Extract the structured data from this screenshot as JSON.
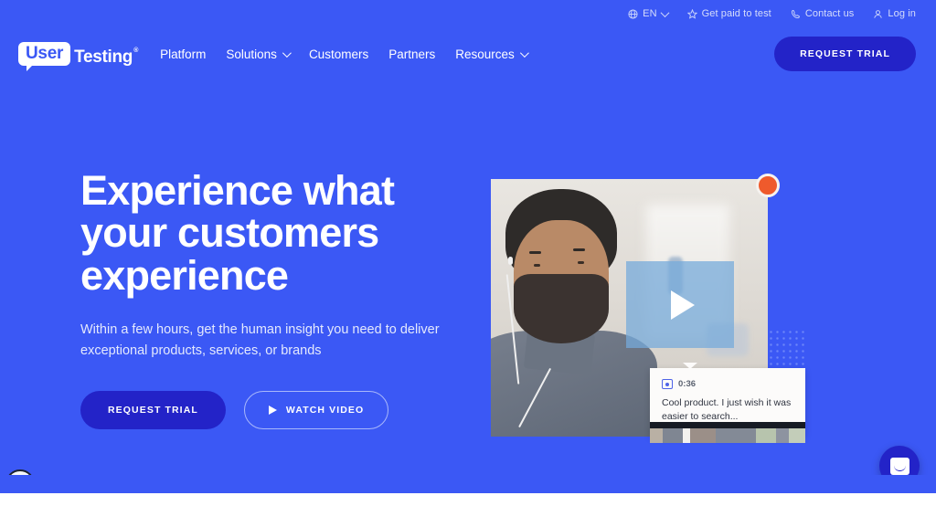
{
  "brand": {
    "logo_bubble_text": "User",
    "logo_word": "Testing",
    "logo_tm": "®",
    "accent_blue": "#3b58f5",
    "button_blue": "#2323c8",
    "record_orange": "#ef5a2c"
  },
  "utility_bar": {
    "items": [
      {
        "icon": "globe-icon",
        "label": "EN",
        "has_chevron": true
      },
      {
        "icon": "star-icon",
        "label": "Get paid to test",
        "has_chevron": false
      },
      {
        "icon": "phone-icon",
        "label": "Contact us",
        "has_chevron": false
      },
      {
        "icon": "user-icon",
        "label": "Log in",
        "has_chevron": false
      }
    ]
  },
  "nav": {
    "links": [
      {
        "label": "Platform",
        "has_chevron": false
      },
      {
        "label": "Solutions",
        "has_chevron": true
      },
      {
        "label": "Customers",
        "has_chevron": false
      },
      {
        "label": "Partners",
        "has_chevron": false
      },
      {
        "label": "Resources",
        "has_chevron": true
      }
    ],
    "cta_label": "REQUEST TRIAL"
  },
  "hero": {
    "headline_line1": "Experience what",
    "headline_line2": "your customers",
    "headline_line3": "experience",
    "subhead": "Within a few hours, get the human insight you need to deliver exceptional products, services, or brands",
    "primary_cta": "REQUEST TRIAL",
    "secondary_cta": "WATCH VIDEO"
  },
  "media": {
    "play_button_name": "play-video",
    "recording_indicator": "recording-dot",
    "comment": {
      "timestamp": "0:36",
      "text": "Cool product. I just wish it was easier to search..."
    }
  },
  "widgets": {
    "accessibility_label": "accessibility-options",
    "chat_label": "open-chat"
  }
}
